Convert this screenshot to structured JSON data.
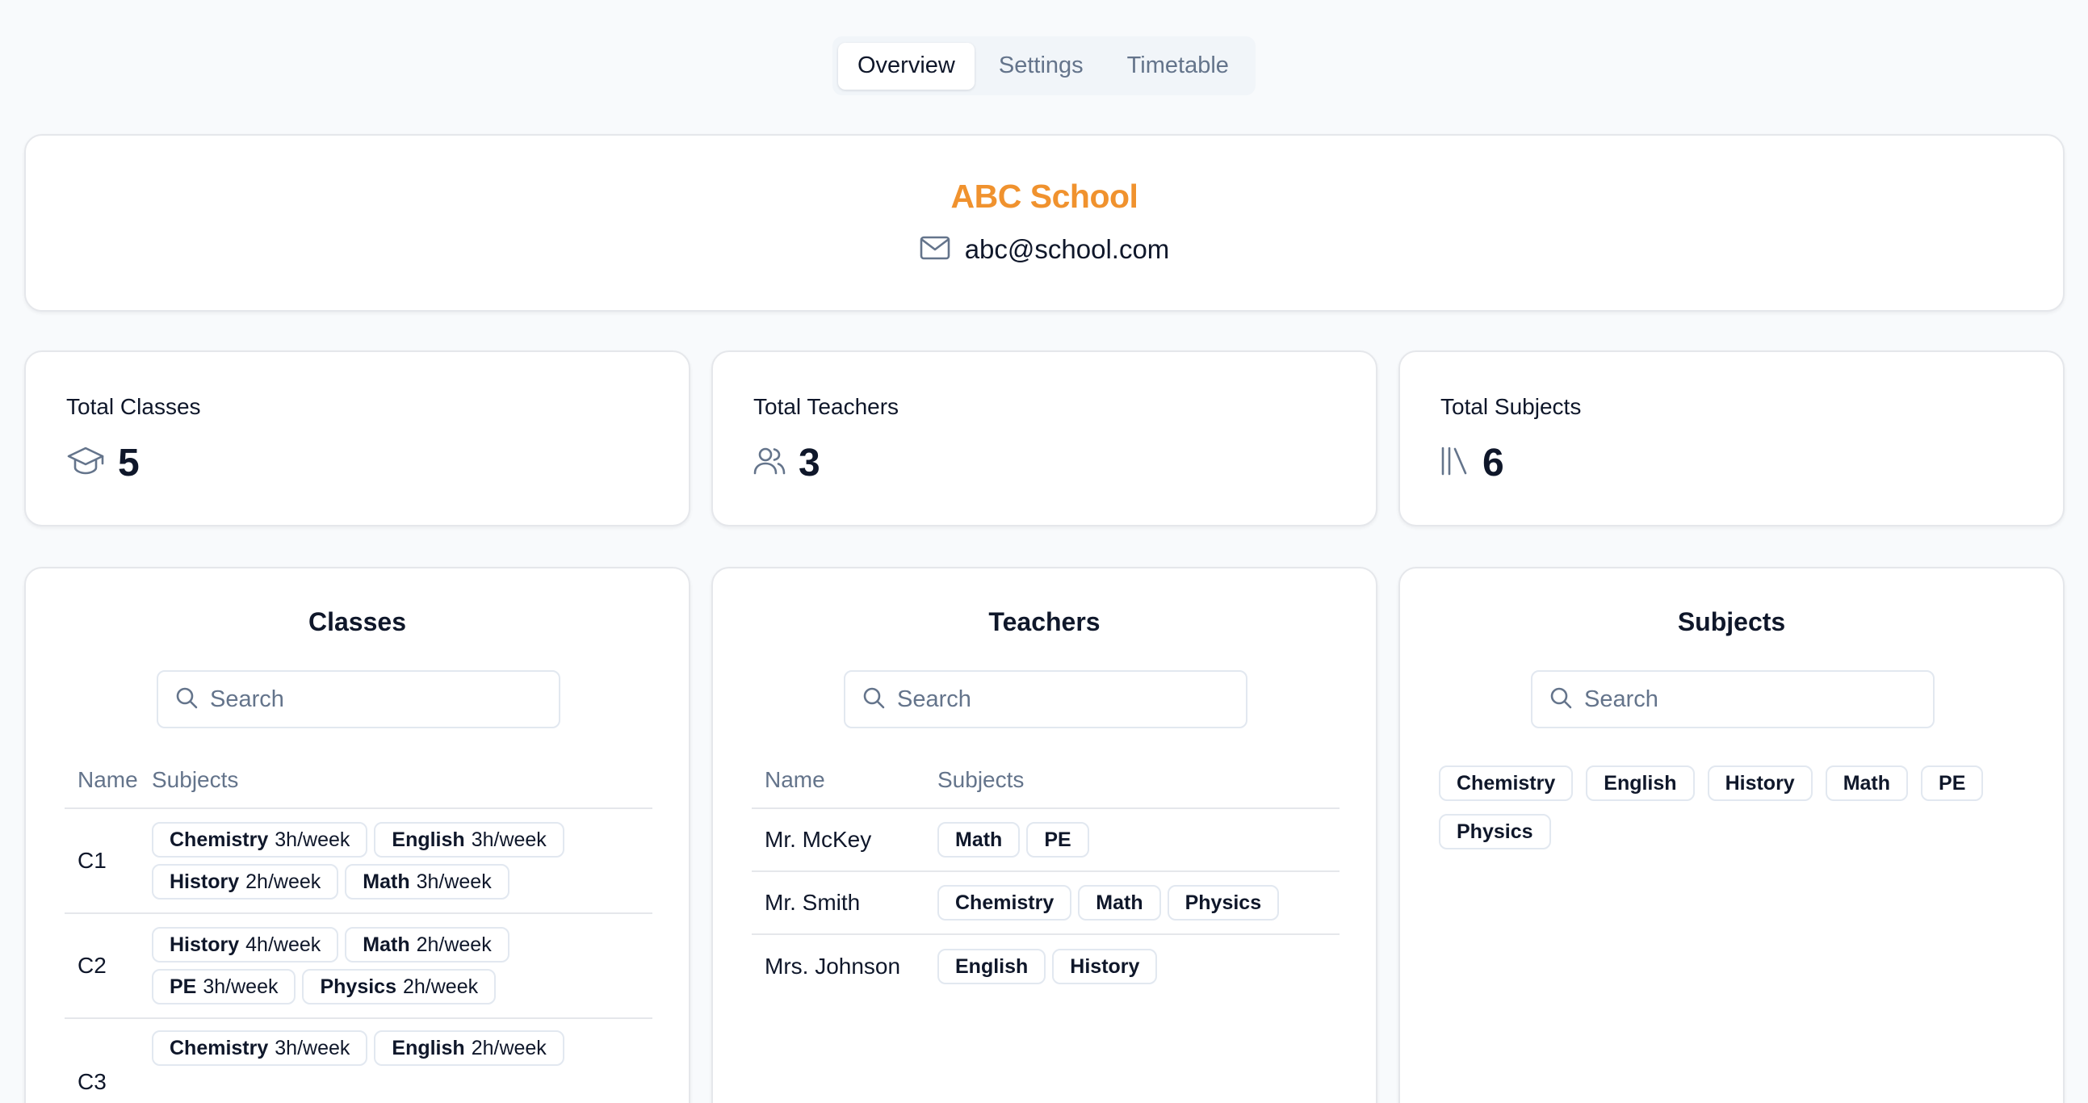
{
  "tabs": [
    {
      "label": "Overview",
      "active": true
    },
    {
      "label": "Settings",
      "active": false
    },
    {
      "label": "Timetable",
      "active": false
    }
  ],
  "school": {
    "name": "ABC School",
    "email": "abc@school.com",
    "name_color": "#f0922e"
  },
  "stats": {
    "classes": {
      "title": "Total Classes",
      "value": "5",
      "icon": "graduation-cap-icon"
    },
    "teachers": {
      "title": "Total Teachers",
      "value": "3",
      "icon": "users-icon"
    },
    "subjects": {
      "title": "Total Subjects",
      "value": "6",
      "icon": "library-icon"
    }
  },
  "classes_panel": {
    "title": "Classes",
    "search_placeholder": "Search",
    "headers": {
      "name": "Name",
      "subjects": "Subjects"
    },
    "rows": [
      {
        "name": "C1",
        "subjects": [
          {
            "subject": "Chemistry",
            "hours": "3h/week"
          },
          {
            "subject": "English",
            "hours": "3h/week"
          },
          {
            "subject": "History",
            "hours": "2h/week"
          },
          {
            "subject": "Math",
            "hours": "3h/week"
          }
        ]
      },
      {
        "name": "C2",
        "subjects": [
          {
            "subject": "History",
            "hours": "4h/week"
          },
          {
            "subject": "Math",
            "hours": "2h/week"
          },
          {
            "subject": "PE",
            "hours": "3h/week"
          },
          {
            "subject": "Physics",
            "hours": "2h/week"
          }
        ]
      },
      {
        "name": "C3",
        "subjects": [
          {
            "subject": "Chemistry",
            "hours": "3h/week"
          },
          {
            "subject": "English",
            "hours": "2h/week"
          }
        ]
      }
    ]
  },
  "teachers_panel": {
    "title": "Teachers",
    "search_placeholder": "Search",
    "headers": {
      "name": "Name",
      "subjects": "Subjects"
    },
    "rows": [
      {
        "name": "Mr. McKey",
        "subjects": [
          "Math",
          "PE"
        ]
      },
      {
        "name": "Mr. Smith",
        "subjects": [
          "Chemistry",
          "Math",
          "Physics"
        ]
      },
      {
        "name": "Mrs. Johnson",
        "subjects": [
          "English",
          "History"
        ]
      }
    ]
  },
  "subjects_panel": {
    "title": "Subjects",
    "search_placeholder": "Search",
    "items": [
      "Chemistry",
      "English",
      "History",
      "Math",
      "PE",
      "Physics"
    ]
  }
}
